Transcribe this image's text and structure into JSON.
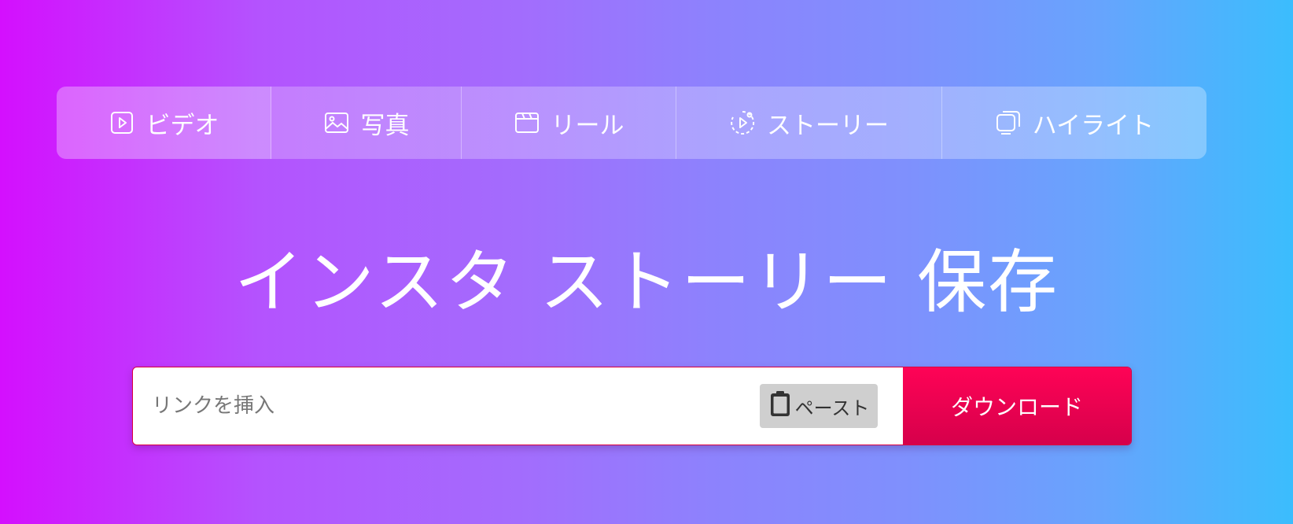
{
  "tabs": [
    {
      "label": "ビデオ",
      "icon": "video-play-icon"
    },
    {
      "label": "写真",
      "icon": "photo-icon"
    },
    {
      "label": "リール",
      "icon": "reel-icon"
    },
    {
      "label": "ストーリー",
      "icon": "story-icon"
    },
    {
      "label": "ハイライト",
      "icon": "highlight-icon"
    }
  ],
  "main": {
    "title": "インスタ ストーリー 保存"
  },
  "search": {
    "placeholder": "リンクを挿入",
    "value": "",
    "paste_label": "ペースト",
    "paste_icon": "clipboard-icon",
    "download_label": "ダウンロード"
  },
  "colors": {
    "gradient_start": "#d40ffe",
    "gradient_end": "#3bbdfd",
    "download_button": "#fe0356",
    "paste_button": "#cfcfcf"
  }
}
